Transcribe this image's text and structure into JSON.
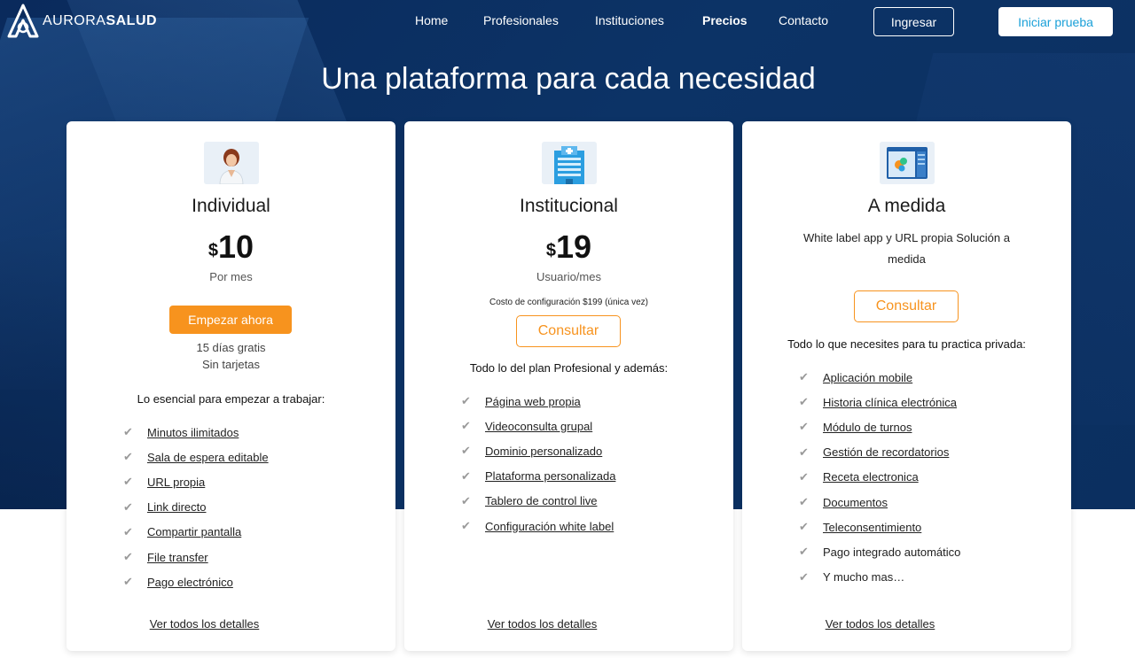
{
  "brand": {
    "name_light": "AURORA",
    "name_bold": "SALUD"
  },
  "nav": {
    "links": [
      "Home",
      "Profesionales",
      "Instituciones",
      "Precios",
      "Contacto"
    ],
    "active": "Precios",
    "login": "Ingresar",
    "trial": "Iniciar prueba"
  },
  "hero": {
    "title": "Una plataforma para cada necesidad"
  },
  "colors": {
    "navy": "#0c3366",
    "accent_orange": "#f7931e",
    "accent_cyan": "#1aa0d8"
  },
  "plans": {
    "individual": {
      "icon": "doctor-icon",
      "title": "Individual",
      "currency": "$",
      "price": "10",
      "period": "Por mes",
      "cta": "Empezar ahora",
      "note_line1": "15 días gratis",
      "note_line2": "Sin tarjetas",
      "features_heading": "Lo esencial para empezar a trabajar:",
      "features": [
        "Minutos ilimitados",
        "Sala de espera editable",
        "URL propia",
        "Link directo",
        "Compartir pantalla",
        "File transfer",
        "Pago electrónico"
      ],
      "details": "Ver todos los detalles"
    },
    "institucional": {
      "icon": "hospital-icon",
      "title": "Institucional",
      "currency": "$",
      "price": "19",
      "period": "Usuario/mes",
      "setup": "Costo de configuración $199 (única vez)",
      "cta": "Consultar",
      "features_heading": "Todo lo del plan Profesional y además:",
      "features": [
        "Página web propia",
        "Videoconsulta grupal",
        "Dominio personalizado",
        "Plataforma personalizada",
        "Tablero de control live",
        "Configuración white label"
      ],
      "details": "Ver todos los detalles"
    },
    "medida": {
      "icon": "custom-app-icon",
      "title": "A medida",
      "description": "White label app y URL propia Solución a medida",
      "cta": "Consultar",
      "features_heading": "Todo lo que necesites para tu practica privada:",
      "features": [
        "Aplicación mobile",
        "Historia clínica electrónica",
        "Módulo de turnos",
        "Gestión de recordatorios",
        "Receta electronica",
        "Documentos",
        "Teleconsentimiento",
        "Pago integrado automático",
        "Y mucho mas…"
      ],
      "details": "Ver todos los detalles"
    }
  }
}
